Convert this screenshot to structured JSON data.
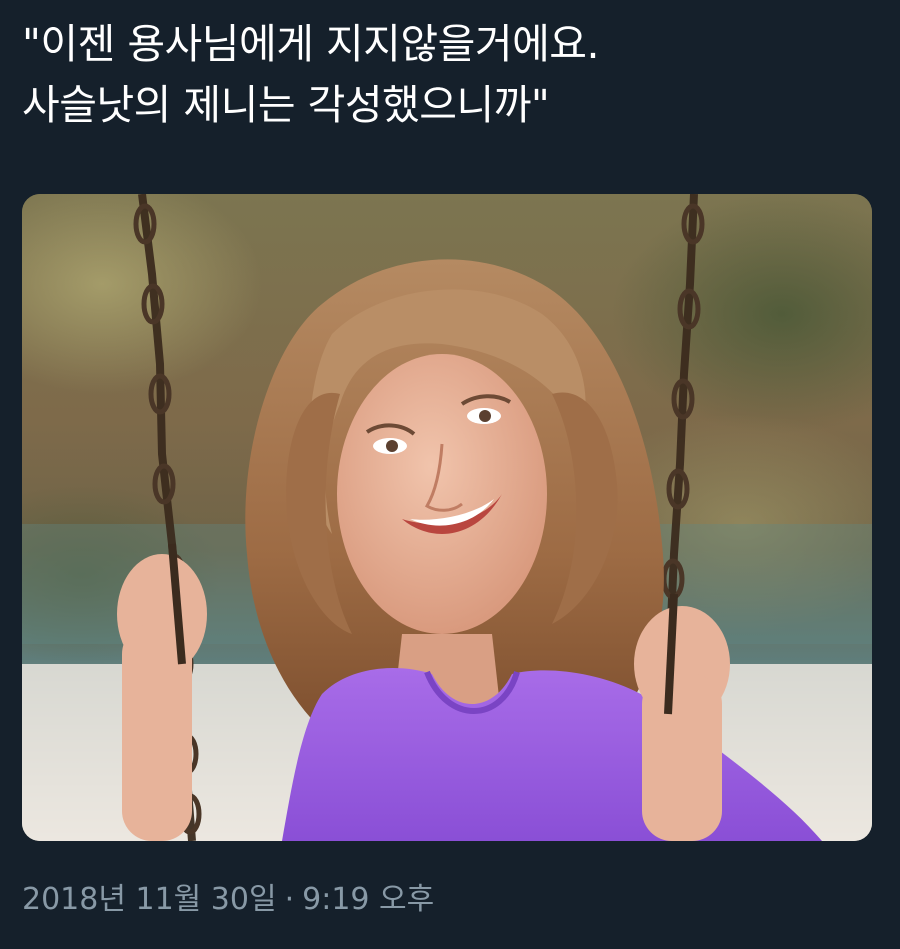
{
  "tweet": {
    "text_lines": [
      "\"이젠 용사님에게 지지않을거에요.",
      "사슬낫의 제니는 각성했으니까\""
    ],
    "media": {
      "description_icon": "photo-icon",
      "shirt_color": "#9b5fe0",
      "background_color": "#6b6a4a"
    },
    "timestamp": {
      "date": "2018년 11월 30일",
      "separator": "·",
      "time": "9:19 오후"
    }
  },
  "theme": {
    "background": "#15202b",
    "text": "#ffffff",
    "muted": "#8899a6"
  }
}
